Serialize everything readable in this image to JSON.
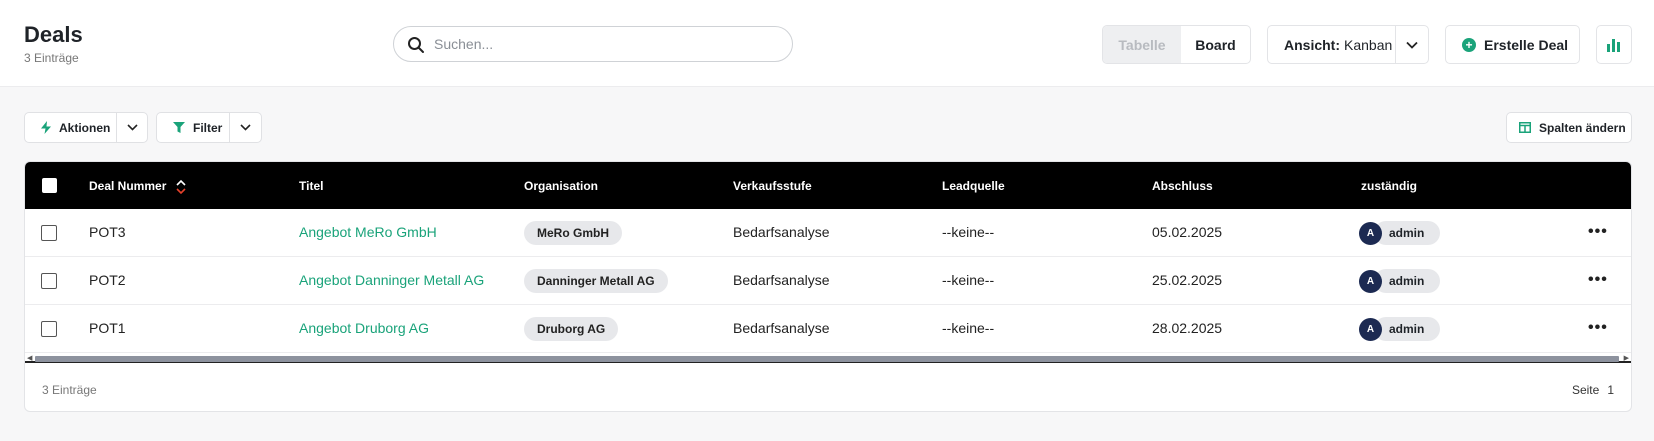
{
  "header": {
    "title": "Deals",
    "subtitle": "3 Einträge",
    "search_placeholder": "Suchen...",
    "view_toggle": {
      "table_label": "Tabelle",
      "board_label": "Board",
      "active": "Board"
    },
    "view_select": {
      "label": "Ansicht:",
      "value": "Kanban"
    },
    "create_label": "Erstelle Deal",
    "chart_icon": "bar-chart-icon"
  },
  "toolbar": {
    "actions_label": "Aktionen",
    "filter_label": "Filter",
    "columns_label": "Spalten ändern"
  },
  "table": {
    "columns": [
      "Deal Nummer",
      "Titel",
      "Organisation",
      "Verkaufsstufe",
      "Leadquelle",
      "Abschluss",
      "zuständig"
    ],
    "rows": [
      {
        "number": "POT3",
        "title": "Angebot MeRo GmbH",
        "organisation": "MeRo GmbH",
        "stage": "Bedarfsanalyse",
        "lead_source": "--keine--",
        "closing": "05.02.2025",
        "owner_initial": "A",
        "owner": "admin"
      },
      {
        "number": "POT2",
        "title": "Angebot Danninger Metall AG",
        "organisation": "Danninger Metall AG",
        "stage": "Bedarfsanalyse",
        "lead_source": "--keine--",
        "closing": "25.02.2025",
        "owner_initial": "A",
        "owner": "admin"
      },
      {
        "number": "POT1",
        "title": "Angebot Druborg AG",
        "organisation": "Druborg AG",
        "stage": "Bedarfsanalyse",
        "lead_source": "--keine--",
        "closing": "28.02.2025",
        "owner_initial": "A",
        "owner": "admin"
      }
    ],
    "more_label": "•••"
  },
  "footer": {
    "count": "3 Einträge",
    "page_label": "Seite",
    "page_number": "1"
  },
  "colors": {
    "accent": "#1aa37a",
    "header_bg": "#000000",
    "avatar_bg": "#1c2a52"
  }
}
